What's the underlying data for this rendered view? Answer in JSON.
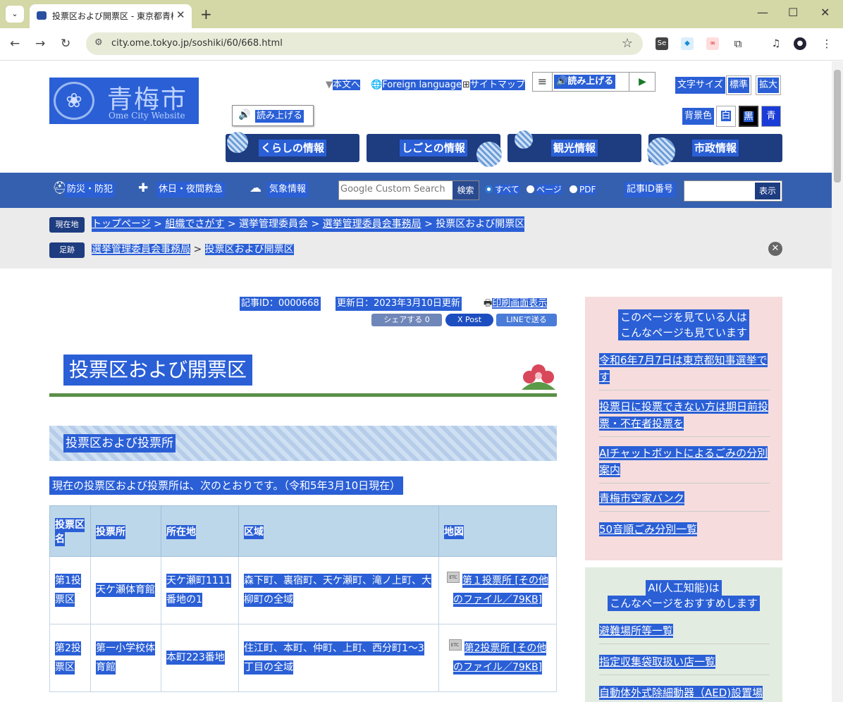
{
  "browser": {
    "tab_title": "投票区および開票区 - 東京都青梅",
    "url": "city.ome.tokyo.jp/soshiki/60/668.html"
  },
  "header": {
    "logo_name": "青梅市",
    "logo_sub": "Ome City Website",
    "links": [
      "本文へ",
      "Foreign language",
      "サイトマップ"
    ],
    "read_aloud": "読み上げる",
    "font_size_label": "文字サイズ",
    "font_standard": "標準",
    "font_large": "拡大",
    "bg_label": "背景色",
    "bg_white": "白",
    "bg_black": "黒",
    "bg_blue": "青"
  },
  "global_nav": [
    "くらしの情報",
    "しごとの情報",
    "観光情報",
    "市政情報"
  ],
  "utility_bar": {
    "items": [
      "防災・防犯",
      "休日・夜間救急",
      "気象情報"
    ],
    "search_placeholder": "Google Custom Search",
    "search_button": "検索",
    "radio_all": "すべて",
    "radio_page": "ページ",
    "radio_pdf": "PDF",
    "id_label": "記事ID番号",
    "id_button": "表示"
  },
  "breadcrumb": {
    "current_label": "現在地",
    "current": [
      "トップページ",
      "組織でさがす",
      "選挙管理委員会",
      "選挙管理委員会事務局",
      "投票区および開票区"
    ],
    "trail_label": "足跡",
    "trail": [
      "選挙管理委員会事務局",
      "投票区および開票区"
    ]
  },
  "article": {
    "article_id": "記事ID：0000668",
    "updated": "更新日：2023年3月10日更新",
    "print": "印刷画面表示",
    "share_fb": "シェアする 0",
    "share_x": "X Post",
    "share_line": "LINEで送る",
    "title": "投票区および開票区",
    "section": "投票区および投票所",
    "lead": "現在の投票区および投票所は、次のとおりです。（令和5年3月10日現在）"
  },
  "table": {
    "headers": [
      "投票区名",
      "投票所",
      "所在地",
      "区域",
      "地図"
    ],
    "rows": [
      [
        "第1投票区",
        "天ケ瀬体育館",
        "天ケ瀬町1111番地の1",
        "森下町、裏宿町、天ケ瀬町、滝ノ上町、大柳町の全域",
        "第１投票所 [その他のファイル／79KB]"
      ],
      [
        "第2投票区",
        "第一小学校体育館",
        "本町223番地",
        "住江町、本町、仲町、上町、西分町1～3丁目の全域",
        "第2投票所 [その他のファイル／79KB]"
      ]
    ]
  },
  "aside": {
    "box1_title_1": "このページを見ている人は",
    "box1_title_2": "こんなページも見ています",
    "box1_items": [
      "令和6年7月7日は東京都知事選挙です",
      "投票日に投票できない方は期日前投票・不在者投票を",
      "AIチャットボットによるごみの分別案内",
      "青梅市空家バンク",
      "50音順ごみ分別一覧"
    ],
    "box2_title_1": "AI(人工知能)は",
    "box2_title_2": "こんなページをおすすめします",
    "box2_items": [
      "避難場所等一覧",
      "指定収集袋取扱い店一覧",
      "自動体外式除細動器（AED)設置場"
    ]
  }
}
